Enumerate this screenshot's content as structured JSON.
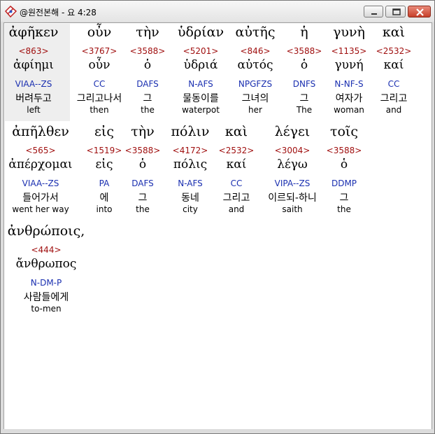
{
  "window": {
    "title": "@원전본해 - 요 4:28",
    "icons": {
      "app": "bible-app-icon",
      "minimize": "minimize-icon",
      "maximize": "maximize-icon",
      "close": "close-icon"
    }
  },
  "lines": [
    {
      "words": [
        {
          "greek": "ἀφῆκεν",
          "strong": "<863>",
          "lemma": "ἀφίημι",
          "parse": "VIAA--ZS",
          "korean": "버려두고",
          "english": "left"
        },
        {
          "greek": "οὖν",
          "strong": "<3767>",
          "lemma": "οὖν",
          "parse": "CC",
          "korean": "그리고나서",
          "english": "then"
        },
        {
          "greek": "τὴν",
          "strong": "<3588>",
          "lemma": "ὁ",
          "parse": "DAFS",
          "korean": "그",
          "english": "the"
        },
        {
          "greek": "ὑδρίαν",
          "strong": "<5201>",
          "lemma": "ὑδριά",
          "parse": "N-AFS",
          "korean": "물동이를",
          "english": "waterpot"
        },
        {
          "greek": "αὐτῆς",
          "strong": "<846>",
          "lemma": "αὐτός",
          "parse": "NPGFZS",
          "korean": "그녀의",
          "english": "her"
        },
        {
          "greek": "ἡ",
          "strong": "<3588>",
          "lemma": "ὁ",
          "parse": "DNFS",
          "korean": "그",
          "english": "The"
        },
        {
          "greek": "γυνὴ",
          "strong": "<1135>",
          "lemma": "γυνή",
          "parse": "N-NF-S",
          "korean": "여자가",
          "english": "woman"
        },
        {
          "greek": "καὶ",
          "strong": "<2532>",
          "lemma": "καί",
          "parse": "CC",
          "korean": "그리고",
          "english": "and"
        }
      ]
    },
    {
      "words": [
        {
          "greek": "ἀπῆλθεν",
          "strong": "<565>",
          "lemma": "ἀπέρχομαι",
          "parse": "VIAA--ZS",
          "korean": "들어가서",
          "english": "went her way"
        },
        {
          "greek": "εἰς",
          "strong": "<1519>",
          "lemma": "εἰς",
          "parse": "PA",
          "korean": "에",
          "english": "into"
        },
        {
          "greek": "τὴν",
          "strong": "<3588>",
          "lemma": "ὁ",
          "parse": "DAFS",
          "korean": "그",
          "english": "the"
        },
        {
          "greek": "πόλιν",
          "strong": "<4172>",
          "lemma": "πόλις",
          "parse": "N-AFS",
          "korean": "동네",
          "english": "city"
        },
        {
          "greek": "καὶ",
          "strong": "<2532>",
          "lemma": "καί",
          "parse": "CC",
          "korean": "그리고",
          "english": "and"
        },
        {
          "greek": "λέγει",
          "strong": "<3004>",
          "lemma": "λέγω",
          "parse": "VIPA--ZS",
          "korean": "이르되-하니",
          "english": "saith"
        },
        {
          "greek": "τοῖς",
          "strong": "<3588>",
          "lemma": "ὁ",
          "parse": "DDMP",
          "korean": "그",
          "english": "the"
        }
      ]
    },
    {
      "words": [
        {
          "greek": "ἀνθρώποις,",
          "strong": "<444>",
          "lemma": "ἄνθρωπος",
          "parse": "N-DM-P",
          "korean": "사람들에게",
          "english": "to-men"
        }
      ]
    }
  ]
}
